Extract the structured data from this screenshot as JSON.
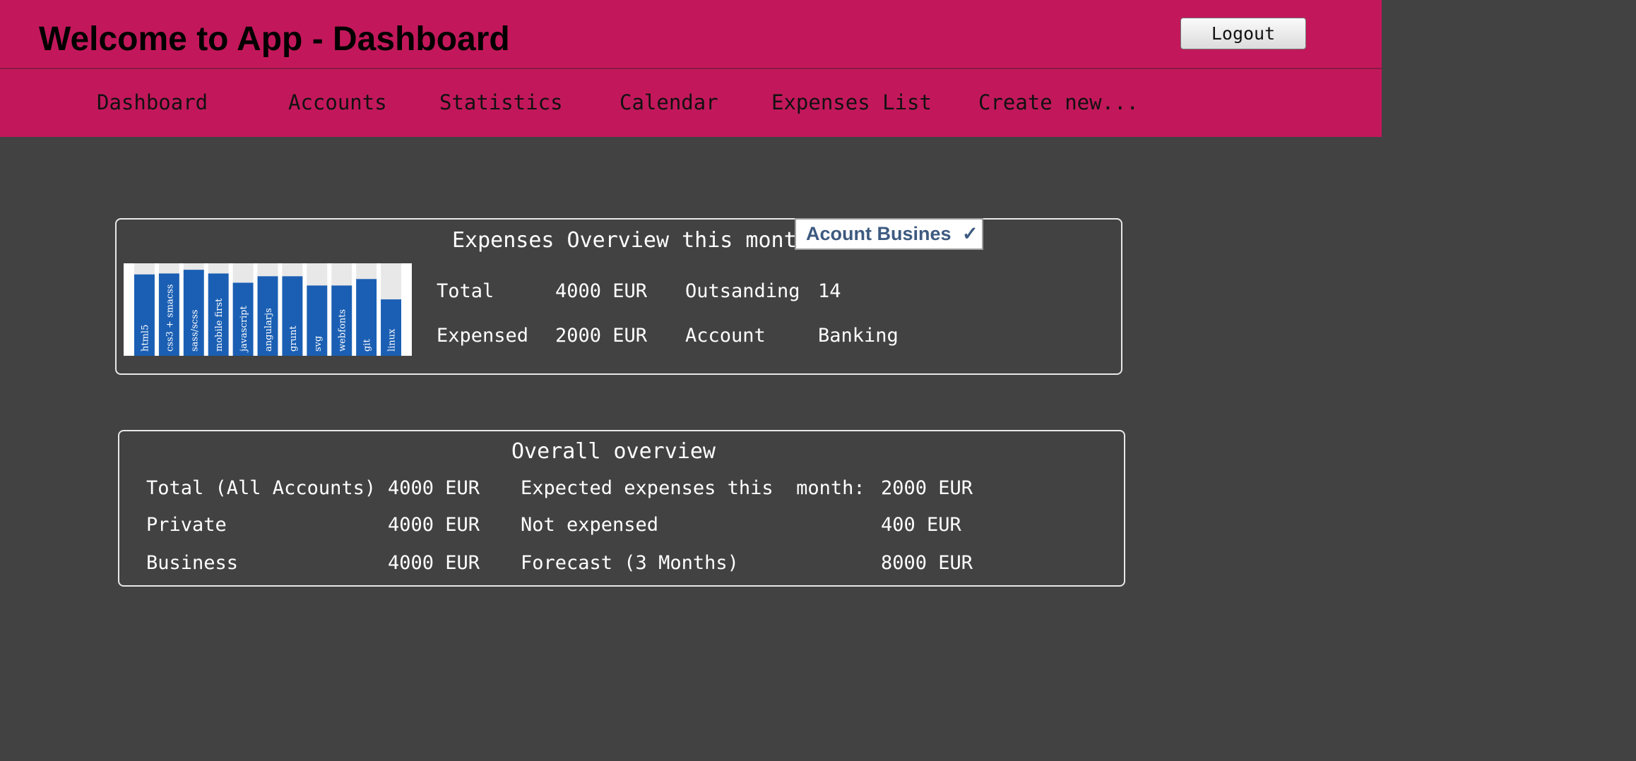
{
  "header": {
    "title": "Welcome to App - Dashboard",
    "logout_label": "Logout"
  },
  "nav": {
    "items": [
      "Dashboard",
      "Accounts",
      "Statistics",
      "Calendar",
      "Expenses List",
      "Create new..."
    ]
  },
  "monthly": {
    "title": "Expenses Overview this month",
    "account_tag": "Acount Busines",
    "account_tag_icon": "checkmark-icon",
    "total_label": "Total",
    "total_value": "4000 EUR",
    "outstanding_label": "Outsanding",
    "outstanding_value": "14",
    "expensed_label": "Expensed",
    "expensed_value": "2000 EUR",
    "account_label": "Account",
    "account_value": "Banking"
  },
  "chart_data": {
    "type": "bar",
    "categories": [
      "html5",
      "css3 + smacss",
      "sass/scss",
      "mobile first",
      "javascript",
      "angularjs",
      "grunt",
      "svg",
      "webfonts",
      "git",
      "linux"
    ],
    "values": [
      88,
      89,
      93,
      89,
      79,
      86,
      86,
      76,
      76,
      83,
      61
    ],
    "ylim": [
      0,
      100
    ],
    "colors": {
      "bar": "#1a5fb4",
      "track": "#e8e8e8"
    }
  },
  "overall": {
    "title": "Overall overview",
    "rows": [
      {
        "label": "Total (All Accounts)",
        "value": "4000 EUR",
        "label2": "Expected expenses this  month:",
        "value2": "2000 EUR"
      },
      {
        "label": "Private",
        "value": "4000 EUR",
        "label2": "Not expensed",
        "value2": "400 EUR"
      },
      {
        "label": "Business",
        "value": "4000 EUR",
        "label2": "Forecast (3 Months)",
        "value2": "8000 EUR"
      }
    ]
  },
  "colors": {
    "header": "#c2185b",
    "background": "#424242",
    "accent_text": "#3d5a80"
  }
}
